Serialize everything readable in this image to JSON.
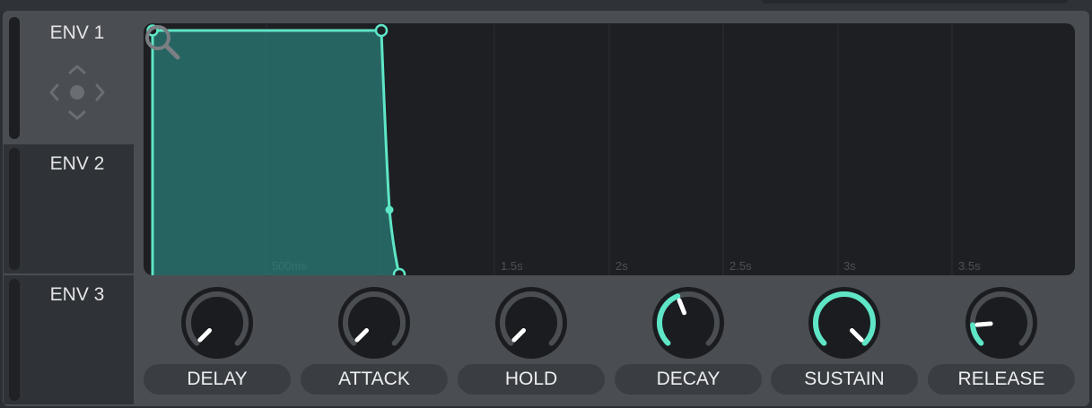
{
  "tabs": [
    {
      "label": "ENV 1",
      "active": true
    },
    {
      "label": "ENV 2",
      "active": false
    },
    {
      "label": "ENV 3",
      "active": false
    }
  ],
  "graph": {
    "time_labels": [
      "500ms",
      "1.5s",
      "2s",
      "2.5s",
      "3s",
      "3.5s"
    ],
    "accent_color": "#5ee6c6",
    "fill_color": "#2a7f7a",
    "zoom_icon": "magnifier-icon"
  },
  "knobs": [
    {
      "label": "DELAY",
      "value": 0.0,
      "active": false
    },
    {
      "label": "ATTACK",
      "value": 0.0,
      "active": false
    },
    {
      "label": "HOLD",
      "value": 0.0,
      "active": false
    },
    {
      "label": "DECAY",
      "value": 0.42,
      "active": true
    },
    {
      "label": "SUSTAIN",
      "value": 1.0,
      "active": true
    },
    {
      "label": "RELEASE",
      "value": 0.15,
      "active": true
    }
  ]
}
